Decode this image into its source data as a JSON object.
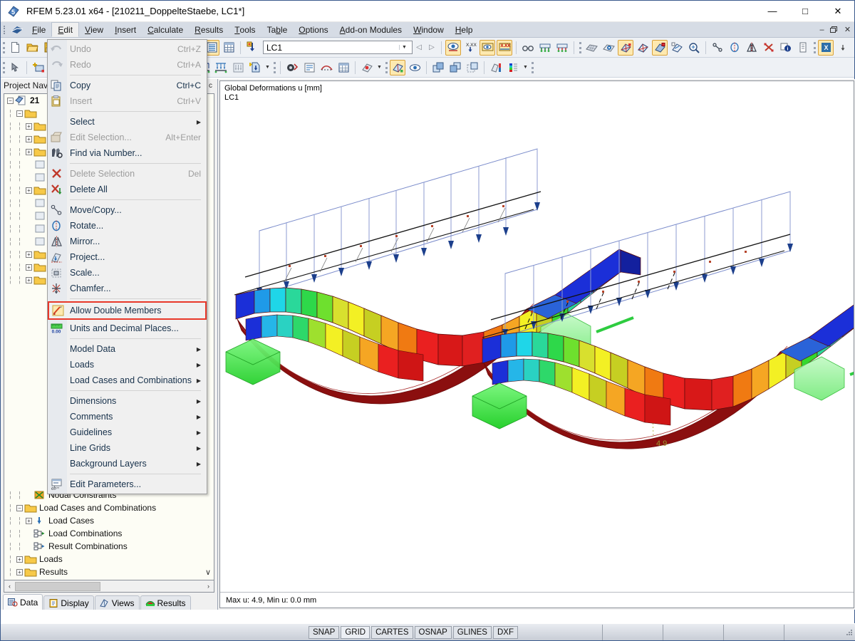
{
  "window": {
    "title": "RFEM 5.23.01 x64 - [210211_DoppelteStaebe, LC1*]",
    "app_icon": "rfem-logo-icon",
    "minimize": "—",
    "maximize": "□",
    "close": "✕",
    "mdi_minimize": "–",
    "mdi_restore": "❐",
    "mdi_close": "✕"
  },
  "menubar": {
    "items": [
      {
        "label": "File",
        "accel": "F"
      },
      {
        "label": "Edit",
        "accel": "E",
        "open": true
      },
      {
        "label": "View",
        "accel": "V"
      },
      {
        "label": "Insert",
        "accel": "I"
      },
      {
        "label": "Calculate",
        "accel": "C"
      },
      {
        "label": "Results",
        "accel": "R"
      },
      {
        "label": "Tools",
        "accel": "T"
      },
      {
        "label": "Table",
        "accel": "b"
      },
      {
        "label": "Options",
        "accel": "O"
      },
      {
        "label": "Add-on Modules",
        "accel": "A"
      },
      {
        "label": "Window",
        "accel": "W"
      },
      {
        "label": "Help",
        "accel": "H"
      }
    ]
  },
  "edit_menu": {
    "items": [
      {
        "label": "Undo",
        "accel": "Ctrl+Z",
        "icon": "undo-icon",
        "enabled": false
      },
      {
        "label": "Redo",
        "accel": "Ctrl+A",
        "icon": "redo-icon",
        "enabled": false
      },
      {
        "separator": true
      },
      {
        "label": "Copy",
        "accel": "Ctrl+C",
        "icon": "copy-icon",
        "enabled": true
      },
      {
        "label": "Insert",
        "accel": "Ctrl+V",
        "icon": "paste-icon",
        "enabled": false
      },
      {
        "separator": true
      },
      {
        "label": "Select",
        "submenu": true,
        "icon": "",
        "enabled": true
      },
      {
        "label": "Edit Selection...",
        "accel": "Alt+Enter",
        "icon": "edit-selection-icon",
        "enabled": false
      },
      {
        "label": "Find via Number...",
        "icon": "find-icon",
        "enabled": true
      },
      {
        "separator": true
      },
      {
        "label": "Delete Selection",
        "accel": "Del",
        "icon": "delete-selection-icon",
        "enabled": false
      },
      {
        "label": "Delete All",
        "icon": "delete-all-icon",
        "enabled": true
      },
      {
        "separator": true
      },
      {
        "label": "Move/Copy...",
        "icon": "move-copy-icon",
        "enabled": true
      },
      {
        "label": "Rotate...",
        "icon": "rotate-icon",
        "enabled": true
      },
      {
        "label": "Mirror...",
        "icon": "mirror-icon",
        "enabled": true
      },
      {
        "label": "Project...",
        "icon": "project-icon",
        "enabled": true
      },
      {
        "label": "Scale...",
        "icon": "scale-icon",
        "enabled": true
      },
      {
        "label": "Chamfer...",
        "icon": "chamfer-icon",
        "enabled": true
      },
      {
        "separator": true
      },
      {
        "label": "Allow Double Members",
        "icon": "allow-double-members-icon",
        "enabled": true,
        "highlighted": true
      },
      {
        "label": "Units and Decimal Places...",
        "icon": "units-icon",
        "enabled": true
      },
      {
        "separator": true
      },
      {
        "label": "Model Data",
        "submenu": true,
        "enabled": true
      },
      {
        "label": "Loads",
        "submenu": true,
        "enabled": true
      },
      {
        "label": "Load Cases and Combinations",
        "submenu": true,
        "enabled": true
      },
      {
        "separator": true
      },
      {
        "label": "Dimensions",
        "submenu": true,
        "enabled": true
      },
      {
        "label": "Comments",
        "submenu": true,
        "enabled": true
      },
      {
        "label": "Guidelines",
        "submenu": true,
        "enabled": true
      },
      {
        "label": "Line Grids",
        "submenu": true,
        "enabled": true
      },
      {
        "label": "Background Layers",
        "submenu": true,
        "enabled": true
      },
      {
        "separator": true
      },
      {
        "label": "Edit Parameters...",
        "icon": "edit-parameters-icon",
        "enabled": true
      }
    ],
    "highlight_color": "#e8382a",
    "submenu_arrow": "▶"
  },
  "toolbar": {
    "load_case_value": "LC1",
    "load_case_placeholder": "LC1",
    "dropdown_arrow": "▼",
    "prev_arrow": "◁",
    "next_arrow": "▷"
  },
  "navigator": {
    "title": "Project Nav",
    "pin_icon": "chevron-left-icon",
    "tree": [
      {
        "depth": 0,
        "label": "21",
        "expander": "−",
        "icon": "model-icon",
        "bold": true
      },
      {
        "depth": 1,
        "label": "",
        "expander": "−",
        "icon": "folder-icon"
      },
      {
        "depth": 2,
        "label": "",
        "expander": "+",
        "icon": "folder-icon"
      },
      {
        "depth": 2,
        "label": "",
        "expander": "+",
        "icon": "folder-icon"
      },
      {
        "depth": 2,
        "label": "",
        "expander": "+",
        "icon": "folder-icon"
      },
      {
        "depth": 2,
        "label": "",
        "expander": "",
        "icon": "item-icon"
      },
      {
        "depth": 2,
        "label": "",
        "expander": "",
        "icon": "item-icon"
      },
      {
        "depth": 2,
        "label": "",
        "expander": "+",
        "icon": "folder-icon"
      },
      {
        "depth": 2,
        "label": "",
        "expander": "",
        "icon": "item-icon"
      },
      {
        "depth": 2,
        "label": "",
        "expander": "",
        "icon": "item-icon"
      },
      {
        "depth": 2,
        "label": "",
        "expander": "",
        "icon": "item-icon"
      },
      {
        "depth": 2,
        "label": "",
        "expander": "",
        "icon": "item-icon"
      },
      {
        "depth": 2,
        "label": "",
        "expander": "+",
        "icon": "folder-icon"
      },
      {
        "depth": 2,
        "label": "",
        "expander": "+",
        "icon": "folder-icon"
      },
      {
        "depth": 2,
        "label": "",
        "expander": "+",
        "icon": "folder-icon"
      }
    ],
    "tree_visible": [
      {
        "depth": 2,
        "label": "Nodal Constraints",
        "expander": "",
        "icon": "nodal-constraints-icon"
      },
      {
        "depth": 1,
        "label": "Load Cases and Combinations",
        "expander": "−",
        "icon": "folder-icon"
      },
      {
        "depth": 2,
        "label": "Load Cases",
        "expander": "+",
        "icon": "load-cases-icon"
      },
      {
        "depth": 2,
        "label": "Load Combinations",
        "expander": "",
        "icon": "load-combinations-icon"
      },
      {
        "depth": 2,
        "label": "Result Combinations",
        "expander": "",
        "icon": "result-combinations-icon"
      },
      {
        "depth": 1,
        "label": "Loads",
        "expander": "+",
        "icon": "folder-icon"
      },
      {
        "depth": 1,
        "label": "Results",
        "expander": "+",
        "icon": "folder-icon"
      }
    ],
    "scroll_left_arrow": "‹",
    "scroll_right_arrow": "›",
    "scroll_down_arrow": "∨",
    "tabs": [
      {
        "label": "Data",
        "icon": "data-icon",
        "active": true
      },
      {
        "label": "Display",
        "icon": "display-icon",
        "active": false
      },
      {
        "label": "Views",
        "icon": "views-icon",
        "active": false
      },
      {
        "label": "Results",
        "icon": "results-icon",
        "active": false
      }
    ]
  },
  "viewport": {
    "title_line1": "Global Deformations u [mm]",
    "title_line2": "LC1",
    "value_label": "4.9",
    "value_label_color": "#9a9a2e",
    "status_text": "Max u: 4.9, Min u: 0.0 mm"
  },
  "statusbar": {
    "toggles": [
      {
        "label": "SNAP",
        "active": false
      },
      {
        "label": "GRID",
        "active": true
      },
      {
        "label": "CARTES",
        "active": false
      },
      {
        "label": "OSNAP",
        "active": false
      },
      {
        "label": "GLINES",
        "active": false
      },
      {
        "label": "DXF",
        "active": false
      }
    ]
  },
  "colors": {
    "accent": "#e8382a",
    "menu_bg": "#d6dce5",
    "toolbar_bg": "#eef1f5",
    "tree_bg": "#fdfdf5",
    "support_green": "#44e04a",
    "load_arrow": "#1a2f8a"
  }
}
